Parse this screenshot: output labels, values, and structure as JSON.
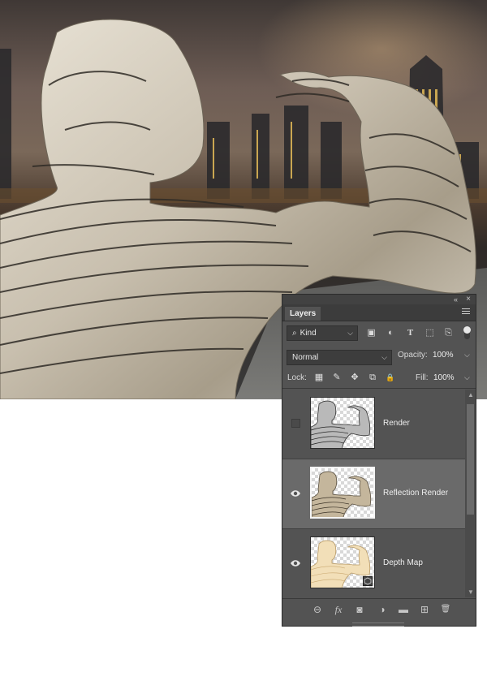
{
  "panel": {
    "title_tab": "Layers",
    "filter": {
      "kind_label": "Kind"
    },
    "blend_mode": "Normal",
    "opacity_label": "Opacity:",
    "opacity_value": "100%",
    "lock_label": "Lock:",
    "fill_label": "Fill:",
    "fill_value": "100%",
    "layers": [
      {
        "name": "Render",
        "visible": false,
        "selected": false
      },
      {
        "name": "Reflection Render",
        "visible": true,
        "selected": true
      },
      {
        "name": "Depth Map",
        "visible": true,
        "selected": false
      }
    ],
    "icons": {
      "collapse": "«",
      "close": "×",
      "search": "⌕",
      "pixel_filter": "▣",
      "adjustment_filter": "◐",
      "type_filter": "T",
      "shape_filter": "⬚",
      "smart_filter": "⎘",
      "lock_pixels": "▦",
      "lock_paint": "✎",
      "lock_move": "✥",
      "lock_artboard": "⧉",
      "lock_all": "🔒",
      "link": "⊖",
      "fx": "fx",
      "mask": "◙",
      "adjustment": "◑",
      "group": "▬",
      "new_layer": "⊞",
      "delete": "🗑"
    }
  }
}
